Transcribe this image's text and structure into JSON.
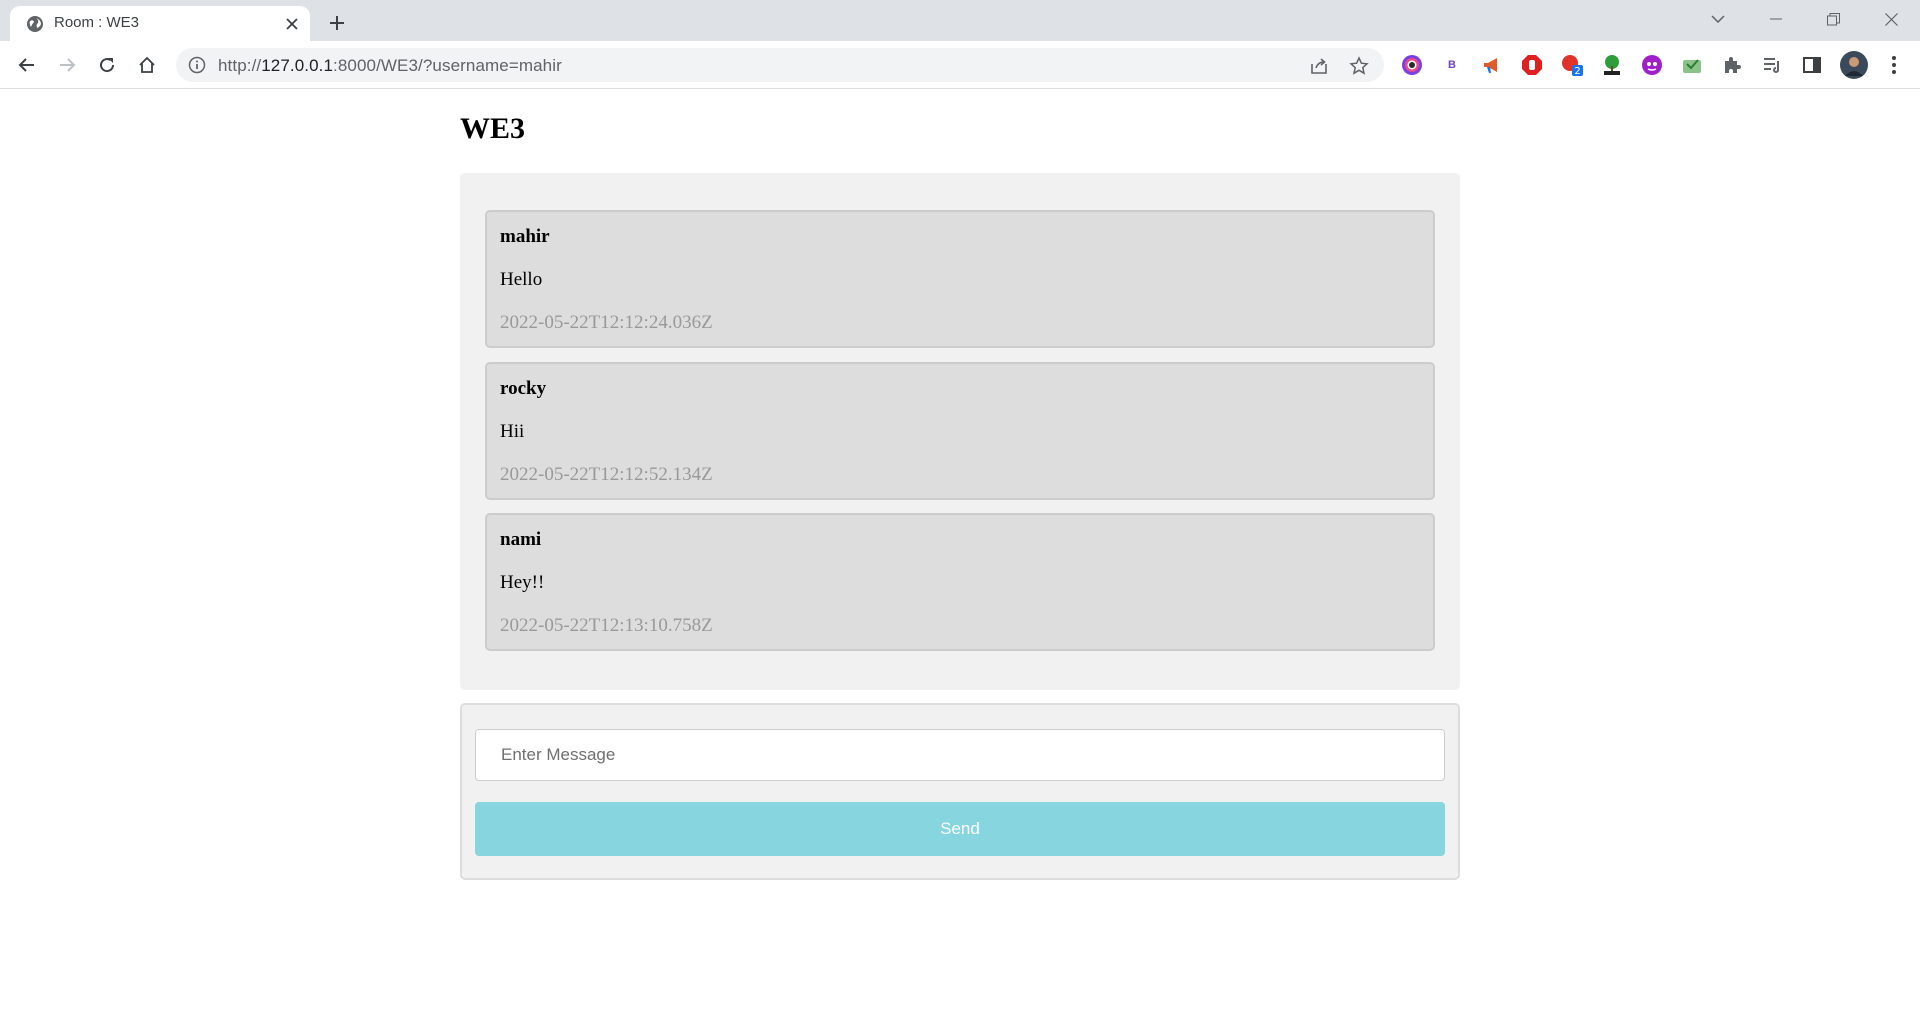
{
  "browser": {
    "tab_title": "Room : WE3",
    "url_host": "127.0.0.1",
    "url_scheme": "http://",
    "url_rest": ":8000/WE3/?username=mahir",
    "extension_badge": "2",
    "ext_b_label": "B"
  },
  "page": {
    "title": "WE3"
  },
  "messages": [
    {
      "user": "mahir",
      "text": "Hello",
      "time": "2022-05-22T12:12:24.036Z"
    },
    {
      "user": "rocky",
      "text": "Hii",
      "time": "2022-05-22T12:12:52.134Z"
    },
    {
      "user": "nami",
      "text": "Hey!!",
      "time": "2022-05-22T12:13:10.758Z"
    }
  ],
  "compose": {
    "placeholder": "Enter Message",
    "send_label": "Send"
  },
  "colors": {
    "send_button": "#86d5df",
    "message_bg": "#dddddd",
    "chat_bg": "#f1f1f1"
  }
}
